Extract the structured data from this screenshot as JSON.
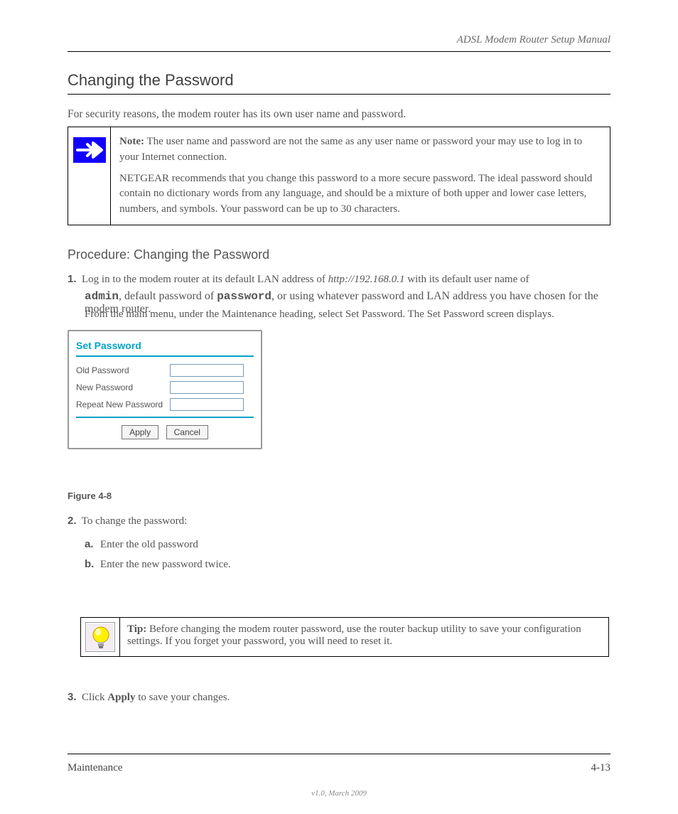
{
  "header": "ADSL Modem Router Setup Manual",
  "section_title": "Changing the Password",
  "intro": "For security reasons, the modem router has its own user name and password.",
  "note": {
    "bold": "Note:",
    "body": "The user name and password are not the same as any user name or password your may use to log in to your Internet connection.",
    "rec_intro": "NETGEAR recommends that you change this password to a more secure password. The ideal password should contain no dictionary words from any language, and should be a mixture of both upper and lower case letters, numbers, and symbols. Your password can be up to 30 characters."
  },
  "proc_heading": "Procedure: Changing the Password",
  "steps": {
    "s1_num": "1.",
    "s1_text": "Log in to the modem router at its default LAN address of",
    "s1_url": "http://192.168.0.1",
    "s1_text2": "with its default user name of",
    "s1_user": "admin",
    "s1_text3": ", default password of",
    "s1_pwd": "password",
    "s1_text4": ", or using whatever password and LAN address you have chosen for the modem router.",
    "s1_from": "From the main menu, under the Maintenance heading, select Set Password. The Set Password screen displays.",
    "s2_num": "2.",
    "s2_text": "To change the password:",
    "s2_a_marker": "a.",
    "s2_a": "Enter the old password",
    "s2_b_marker": "b.",
    "s2_b": "Enter the new password twice.",
    "s3_num": "3.",
    "s3_text": "Click ",
    "s3_bold": "Apply",
    "s3_tail": " to save your changes."
  },
  "dialog": {
    "title": "Set Password",
    "field1": "Old Password",
    "field2": "New Password",
    "field3": "Repeat New Password",
    "apply": "Apply",
    "cancel": "Cancel"
  },
  "figure_caption": "Figure 4-8",
  "tip": {
    "bold": "Tip:",
    "body": "Before changing the modem router password, use the router backup utility to save your configuration settings. If you forget your password, you will need to reset it."
  },
  "footer": {
    "left": "Maintenance",
    "right": "4-13",
    "version": "v1.0, March 2009"
  }
}
